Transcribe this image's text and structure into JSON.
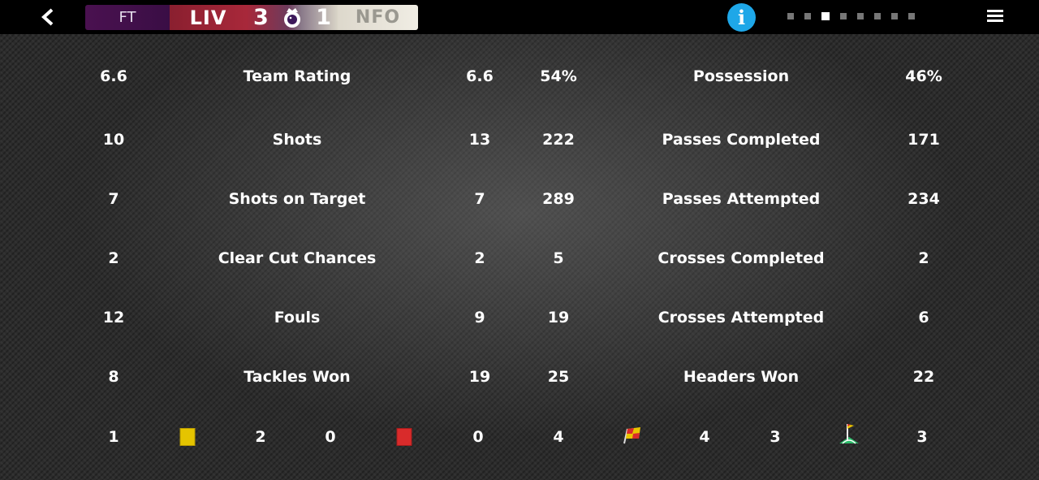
{
  "header": {
    "status": "FT",
    "home_team": "LIV",
    "home_score": "3",
    "away_score": "1",
    "away_team": "NFO",
    "page_dots": 8,
    "active_dot": 3,
    "icons": {
      "back": "chevron-left-icon",
      "info": "info-icon",
      "menu": "hamburger-menu-icon",
      "league": "premier-league-logo"
    },
    "colors": {
      "info": "#1ea7e8",
      "home": "#a8283a",
      "status_bg": "#3a0e45"
    }
  },
  "left_stats": [
    {
      "home": "6.6",
      "label": "Team Rating",
      "away": "6.6"
    },
    {
      "home": "10",
      "label": "Shots",
      "away": "13"
    },
    {
      "home": "7",
      "label": "Shots on Target",
      "away": "7"
    },
    {
      "home": "2",
      "label": "Clear Cut Chances",
      "away": "2"
    },
    {
      "home": "12",
      "label": "Fouls",
      "away": "9"
    },
    {
      "home": "8",
      "label": "Tackles Won",
      "away": "19"
    }
  ],
  "right_stats": [
    {
      "home": "54%",
      "label": "Possession",
      "away": "46%"
    },
    {
      "home": "222",
      "label": "Passes Completed",
      "away": "171"
    },
    {
      "home": "289",
      "label": "Passes Attempted",
      "away": "234"
    },
    {
      "home": "5",
      "label": "Crosses Completed",
      "away": "2"
    },
    {
      "home": "19",
      "label": "Crosses Attempted",
      "away": "6"
    },
    {
      "home": "25",
      "label": "Headers Won",
      "away": "22"
    }
  ],
  "bottom_row": {
    "yellow_home": "1",
    "yellow_away": "2",
    "red_home": "0",
    "red_away": "0",
    "offside_home": "4",
    "offside_away": "4",
    "corner_home": "3",
    "corner_away": "3",
    "icons": {
      "yellow": "yellow-card-icon",
      "red": "red-card-icon",
      "offside": "offside-flag-icon",
      "corner": "corner-flag-icon"
    }
  }
}
